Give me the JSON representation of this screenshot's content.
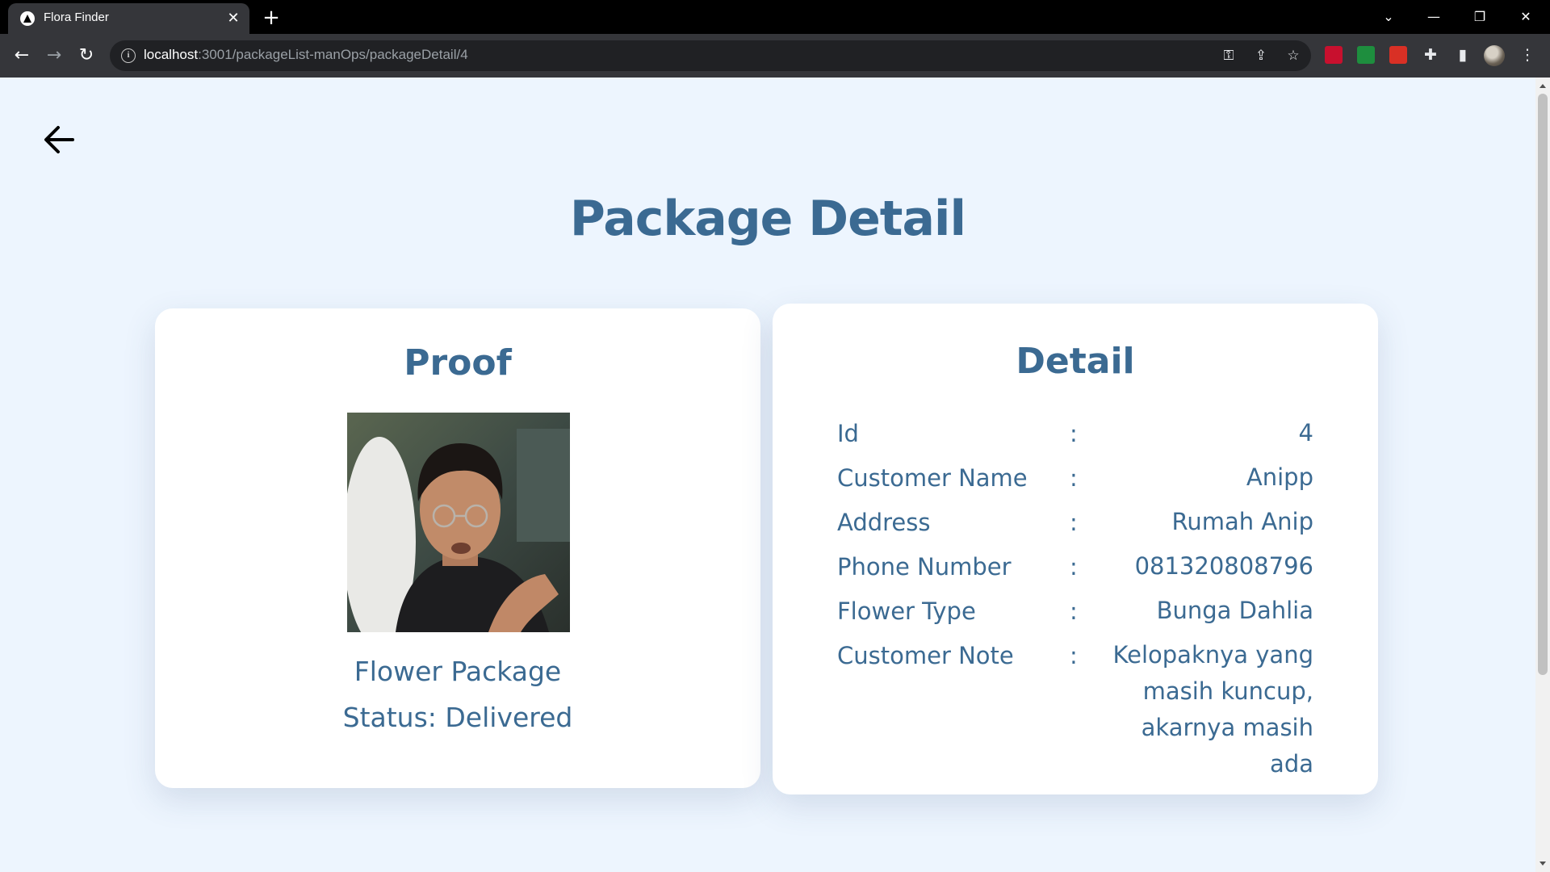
{
  "browser": {
    "tab_title": "Flora Finder",
    "url_host": "localhost",
    "url_path": ":3001/packageList-manOps/packageDetail/4"
  },
  "page": {
    "title": "Package Detail"
  },
  "proof": {
    "heading": "Proof",
    "caption_line1": "Flower Package",
    "caption_line2": "Status: Delivered"
  },
  "detail": {
    "heading": "Detail",
    "separator": ":",
    "rows": [
      {
        "label": "Id",
        "value": "4"
      },
      {
        "label": "Customer Name",
        "value": "Anipp"
      },
      {
        "label": "Address",
        "value": "Rumah Anip"
      },
      {
        "label": "Phone Number",
        "value": "081320808796"
      },
      {
        "label": "Flower Type",
        "value": "Bunga Dahlia"
      },
      {
        "label": "Customer Note",
        "value": "Kelopaknya yang masih kuncup, akarnya masih ada"
      }
    ]
  },
  "colors": {
    "page_background": "#edf5fe",
    "accent_text": "#3b6a92",
    "card_background": "#ffffff"
  }
}
